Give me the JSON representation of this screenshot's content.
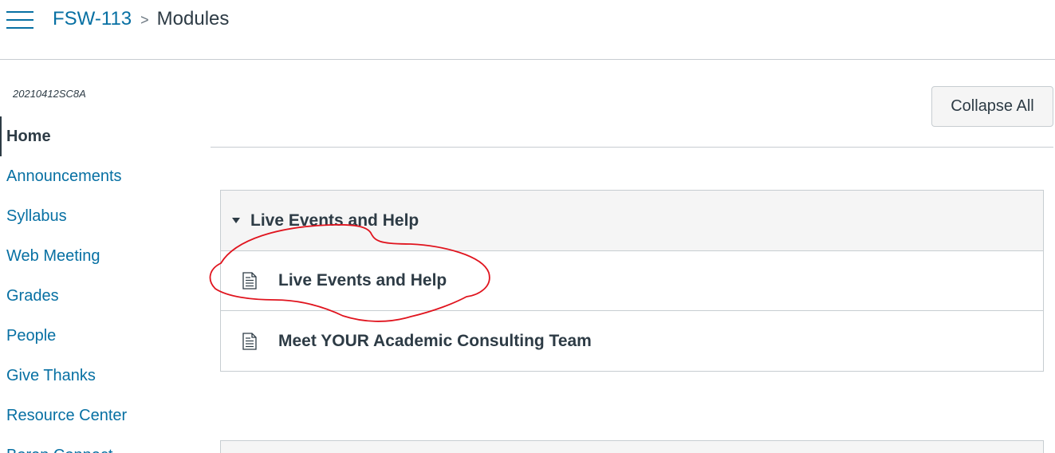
{
  "header": {
    "menu_icon": "hamburger-icon",
    "breadcrumb": {
      "course": "FSW-113",
      "separator": ">",
      "current": "Modules"
    }
  },
  "sidebar": {
    "term": "20210412SC8A",
    "items": [
      {
        "label": "Home",
        "active": true
      },
      {
        "label": "Announcements"
      },
      {
        "label": "Syllabus"
      },
      {
        "label": "Web Meeting"
      },
      {
        "label": "Grades"
      },
      {
        "label": "People"
      },
      {
        "label": "Give Thanks"
      },
      {
        "label": "Resource Center"
      },
      {
        "label": "Boren Connect"
      }
    ]
  },
  "toolbar": {
    "collapse_label": "Collapse All"
  },
  "modules": [
    {
      "title": "Live Events and Help",
      "items": [
        {
          "title": "Live Events and Help",
          "icon": "page-icon"
        },
        {
          "title": "Meet YOUR Academic Consulting Team",
          "icon": "page-icon"
        }
      ]
    }
  ],
  "colors": {
    "link": "#0770a3",
    "text": "#2d3b45",
    "border": "#c7cdd1",
    "header_bg": "#f5f5f5",
    "annotation": "#e0141e"
  }
}
